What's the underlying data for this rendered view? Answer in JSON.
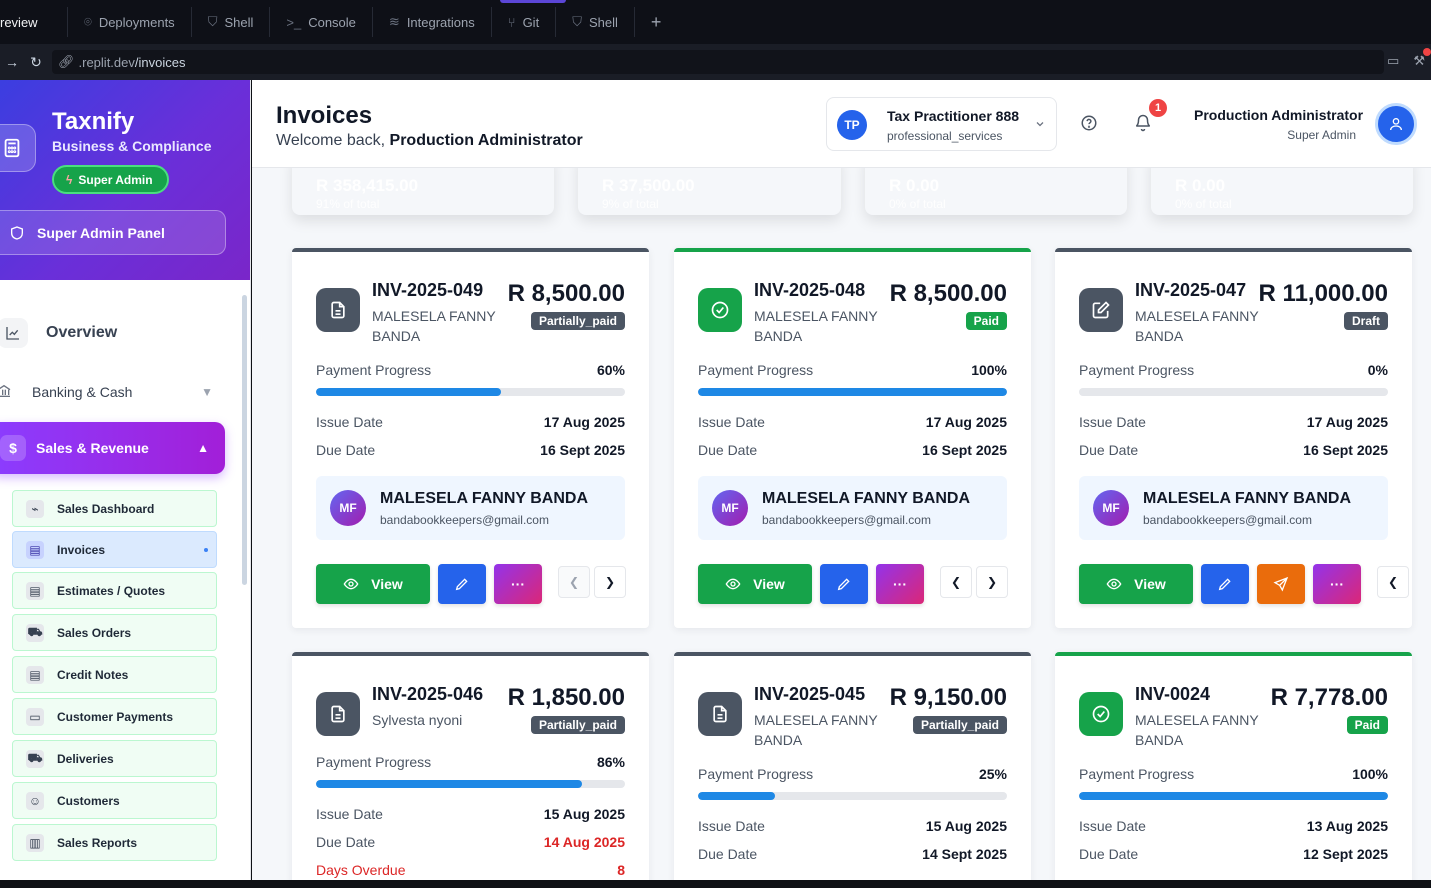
{
  "browser": {
    "tabs": [
      {
        "label": "review",
        "icon": ""
      },
      {
        "label": "Deployments",
        "icon": "⌾"
      },
      {
        "label": "Shell",
        "icon": "⛉"
      },
      {
        "label": "Console",
        "icon": ">_"
      },
      {
        "label": "Integrations",
        "icon": "≋"
      },
      {
        "label": "Git",
        "icon": "⑂"
      },
      {
        "label": "Shell",
        "icon": "⛉"
      }
    ],
    "add_tab": "+",
    "url_dim": ".replit.dev",
    "url_path": "/invoices"
  },
  "brand": {
    "title": "Taxnify",
    "subtitle": "Business & Compliance",
    "badge": "Super Admin",
    "panel_button": "Super Admin Panel"
  },
  "sidebar": {
    "overview": "Overview",
    "banking": "Banking & Cash",
    "sales": "Sales & Revenue",
    "sub_items": [
      "Sales Dashboard",
      "Invoices",
      "Estimates / Quotes",
      "Sales Orders",
      "Credit Notes",
      "Customer Payments",
      "Deliveries",
      "Customers",
      "Sales Reports"
    ]
  },
  "header": {
    "title": "Invoices",
    "welcome_prefix": "Welcome back, ",
    "welcome_name": "Production Administrator",
    "tenant_initials": "TP",
    "tenant_name": "Tax Practitioner 888",
    "tenant_type": "professional_services",
    "notifications": "1",
    "user_name": "Production Administrator",
    "user_role": "Super Admin"
  },
  "summary": [
    {
      "amount": "R 358,415.00",
      "pct": "91% of total",
      "color": "#16a34a"
    },
    {
      "amount": "R 37,500.00",
      "pct": "9% of total",
      "color": "#f59e0b"
    },
    {
      "amount": "R 0.00",
      "pct": "0% of total",
      "color": "#f0502f"
    },
    {
      "amount": "R 0.00",
      "pct": "0% of total",
      "color": "#e11d58"
    }
  ],
  "labels": {
    "payment_progress": "Payment Progress",
    "issue_date": "Issue Date",
    "due_date": "Due Date",
    "days_overdue": "Days Overdue",
    "view": "View",
    "more": "···"
  },
  "invoices": [
    {
      "number": "INV-2025-049",
      "client": "MALESELA FANNY BANDA",
      "amount": "R 8,500.00",
      "status": "Partially_paid",
      "progress_label": "60%",
      "progress": 0.6,
      "issue": "17 Aug 2025",
      "due": "16 Sept 2025",
      "contact_initials": "MF",
      "contact_name": "MALESELA FANNY BANDA",
      "contact_email": "bandabookkeepers@gmail.com"
    },
    {
      "number": "INV-2025-048",
      "client": "MALESELA FANNY BANDA",
      "amount": "R 8,500.00",
      "status": "Paid",
      "progress_label": "100%",
      "progress": 1.0,
      "issue": "17 Aug 2025",
      "due": "16 Sept 2025",
      "contact_initials": "MF",
      "contact_name": "MALESELA FANNY BANDA",
      "contact_email": "bandabookkeepers@gmail.com"
    },
    {
      "number": "INV-2025-047",
      "client": "MALESELA FANNY BANDA",
      "amount": "R 11,000.00",
      "status": "Draft",
      "progress_label": "0%",
      "progress": 0.0,
      "issue": "17 Aug 2025",
      "due": "16 Sept 2025",
      "contact_initials": "MF",
      "contact_name": "MALESELA FANNY BANDA",
      "contact_email": "bandabookkeepers@gmail.com"
    },
    {
      "number": "INV-2025-046",
      "client": "Sylvesta nyoni",
      "amount": "R 1,850.00",
      "status": "Partially_paid",
      "progress_label": "86%",
      "progress": 0.86,
      "issue": "15 Aug 2025",
      "due": "14 Aug 2025",
      "overdue": "8"
    },
    {
      "number": "INV-2025-045",
      "client": "MALESELA FANNY BANDA",
      "amount": "R 9,150.00",
      "status": "Partially_paid",
      "progress_label": "25%",
      "progress": 0.25,
      "issue": "15 Aug 2025",
      "due": "14 Sept 2025"
    },
    {
      "number": "INV-0024",
      "client": "MALESELA FANNY BANDA",
      "amount": "R 7,778.00",
      "status": "Paid",
      "progress_label": "100%",
      "progress": 1.0,
      "issue": "13 Aug 2025",
      "due": "12 Sept 2025"
    }
  ],
  "colors": {
    "paid": "#16a34a",
    "partial": "#4b5563",
    "draft": "#4b5563",
    "overdue": "#dc2626",
    "progress": "#1e88e5",
    "sales_accent": "#8b3dff"
  }
}
